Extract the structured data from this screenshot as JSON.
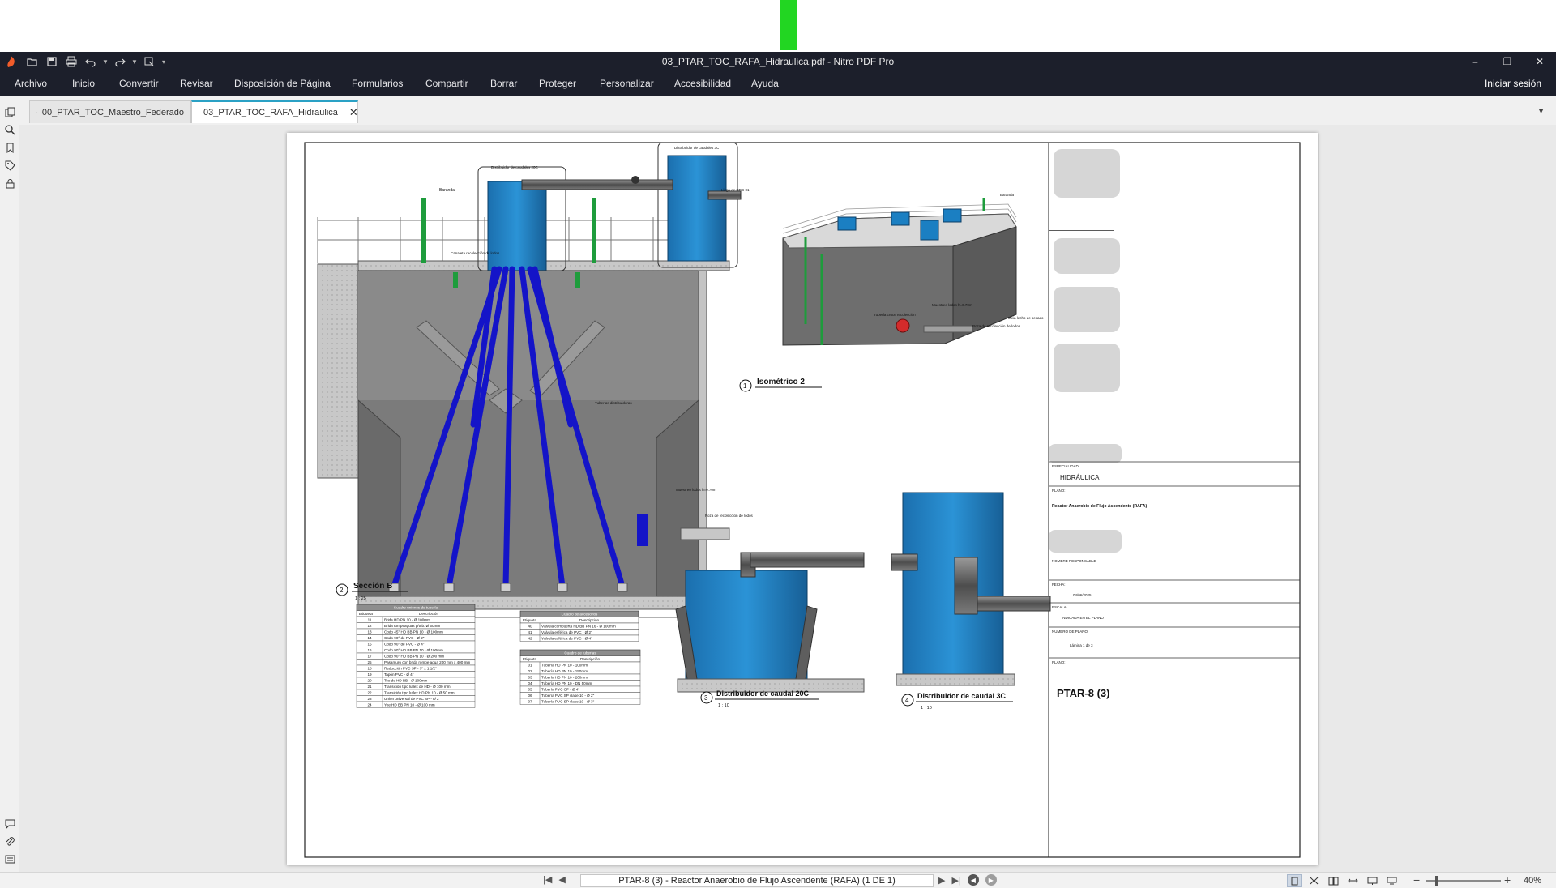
{
  "colors": {
    "green_bar": "#22d622",
    "app_dark": "#1c1f2b",
    "pipe_blue": "#1414c8",
    "tank_blue": "#1b7fc2",
    "concrete": "#7b7b7b",
    "pipe_green": "#1e9c3c"
  },
  "window": {
    "title": "03_PTAR_TOC_RAFA_Hidraulica.pdf - Nitro PDF Pro",
    "app_icon": "nitro-logo-icon",
    "quick_access": [
      "open-folder-icon",
      "save-icon",
      "print-icon",
      "undo-icon",
      "redo-icon",
      "dropdown-icon",
      "customize-icon"
    ]
  },
  "menu": {
    "items": [
      "Archivo",
      "Inicio",
      "Convertir",
      "Revisar",
      "Disposición de Página",
      "Formularios",
      "Compartir",
      "Borrar",
      "Proteger",
      "Personalizar",
      "Accesibilidad",
      "Ayuda"
    ],
    "signin": "Iniciar sesión"
  },
  "sidebar": {
    "icons": [
      "pages-icon",
      "search-icon",
      "bookmark-icon",
      "tag-icon",
      "lock-icon",
      "comments-icon",
      "attachment-icon",
      "fields-icon"
    ]
  },
  "tabs": [
    {
      "label": "00_PTAR_TOC_Maestro_Federado",
      "active": false
    },
    {
      "label": "03_PTAR_TOC_RAFA_Hidraulica",
      "active": true
    }
  ],
  "drawing": {
    "views": {
      "section": {
        "number": "2",
        "title": "Sección B",
        "scale": "1 : 25"
      },
      "isometric": {
        "number": "1",
        "title": "Isométrico 2"
      },
      "dist20": {
        "number": "3",
        "title": "Distribuidor de caudal 20C",
        "scale": "1 : 10"
      },
      "dist3": {
        "number": "4",
        "title": "Distribuidor de caudal 3C",
        "scale": "1 : 10"
      }
    },
    "labels": {
      "baranda": "Baranda",
      "dist20_top": "Distribuidor de caudales 20C",
      "dist3_top": "Distribuidor de caudales 3C",
      "llega": "Llega de DDC 01",
      "canaleta": "Canaleta recolección de lodos",
      "muestreo": "Muestreo lodos h=0.70m",
      "poza": "Poza de recolección de lodos",
      "tuberias": "Tuberías distribuidoras",
      "hacia": "Hacia lecho de secado",
      "tuberia_cruce": "Tubería cruce recolección"
    },
    "tables": {
      "unions": {
        "title": "Cuadro uniones de tubería",
        "headers": [
          "Etiqueta",
          "Descripción"
        ],
        "rows": [
          [
            "11",
            "Brida HD PN 10 - Ø 100mm"
          ],
          [
            "12",
            "Brida rompeaguas p/tub. Ø 50mm"
          ],
          [
            "13",
            "Codo 45° HD BB PN 10 - Ø 100mm"
          ],
          [
            "14",
            "Codo 90° de PVC - Ø 2\""
          ],
          [
            "15",
            "Codo 90° de PVC - Ø 4\""
          ],
          [
            "16",
            "Codo 90° HD BB PN 10 - Ø 100mm"
          ],
          [
            "17",
            "Codo 90° HD BB PN 10 - Ø 200 mm"
          ],
          [
            "25",
            "Pasamuro con brida rompe agua 200 mm x 400 mm"
          ],
          [
            "18",
            "Reducción PVC SP - 3\" x 1 1/2\""
          ],
          [
            "19",
            "Tapón PVC - Ø 4\""
          ],
          [
            "20",
            "Tee de HD BB - Ø 100mm"
          ],
          [
            "21",
            "Transición tipo luflex de HD - Ø 100 mm"
          ],
          [
            "22",
            "Transición tipo luflex HD PN 10 - Ø 50 mm"
          ],
          [
            "23",
            "Unión universal de PVC SP - Ø 2\""
          ],
          [
            "24",
            "Yee HD BB PN 10 - Ø 100 mm"
          ]
        ]
      },
      "accessories": {
        "title": "Cuadro de accesorios",
        "headers": [
          "Etiqueta",
          "Descripción"
        ],
        "rows": [
          [
            "40",
            "Válvula compuerta HD BB PN 16 - Ø 100mm"
          ],
          [
            "41",
            "Válvula esférica de PVC - Ø 2\""
          ],
          [
            "42",
            "Válvula esférica de PVC - Ø 4\""
          ]
        ]
      },
      "pipes": {
        "title": "Cuadro de tuberías",
        "headers": [
          "Etiqueta",
          "Descripción"
        ],
        "rows": [
          [
            "01",
            "Tubería HD PN 10 - 100mm"
          ],
          [
            "02",
            "Tubería HD PN 10 - 150mm"
          ],
          [
            "03",
            "Tubería HD PN 10 - 200mm"
          ],
          [
            "04",
            "Tubería HD PN 10 - DN 50mm"
          ],
          [
            "05",
            "Tubería PVC CP - Ø 4\""
          ],
          [
            "06",
            "Tubería PVC SP clase 10 - Ø 2\""
          ],
          [
            "07",
            "Tubería PVC SP clase 10 - Ø 3\""
          ]
        ]
      }
    },
    "title_block": {
      "especialidad_label": "ESPECIALIDAD:",
      "especialidad": "HIDRÁULICA",
      "plano_label": "PLANO:",
      "plano": "Reactor Anaerobio de Flujo Ascendente (RAFA)",
      "responsable": "NOMBRE RESPONSABLE",
      "fecha_label": "FECHA:",
      "fecha": "04/06/2025",
      "escala_label": "ESCALA:",
      "escala": "INDICADA EN EL PLANO",
      "numero_label": "NUMERO DE PLANO:",
      "numero": "Lámina 1 de 3",
      "plano2_label": "PLANO:",
      "codigo": "PTAR-8 (3)"
    }
  },
  "status": {
    "page_label": "PTAR-8 (3) - Reactor Anaerobio de Flujo Ascendente (RAFA)  (1 DE 1)",
    "zoom": "40%"
  }
}
